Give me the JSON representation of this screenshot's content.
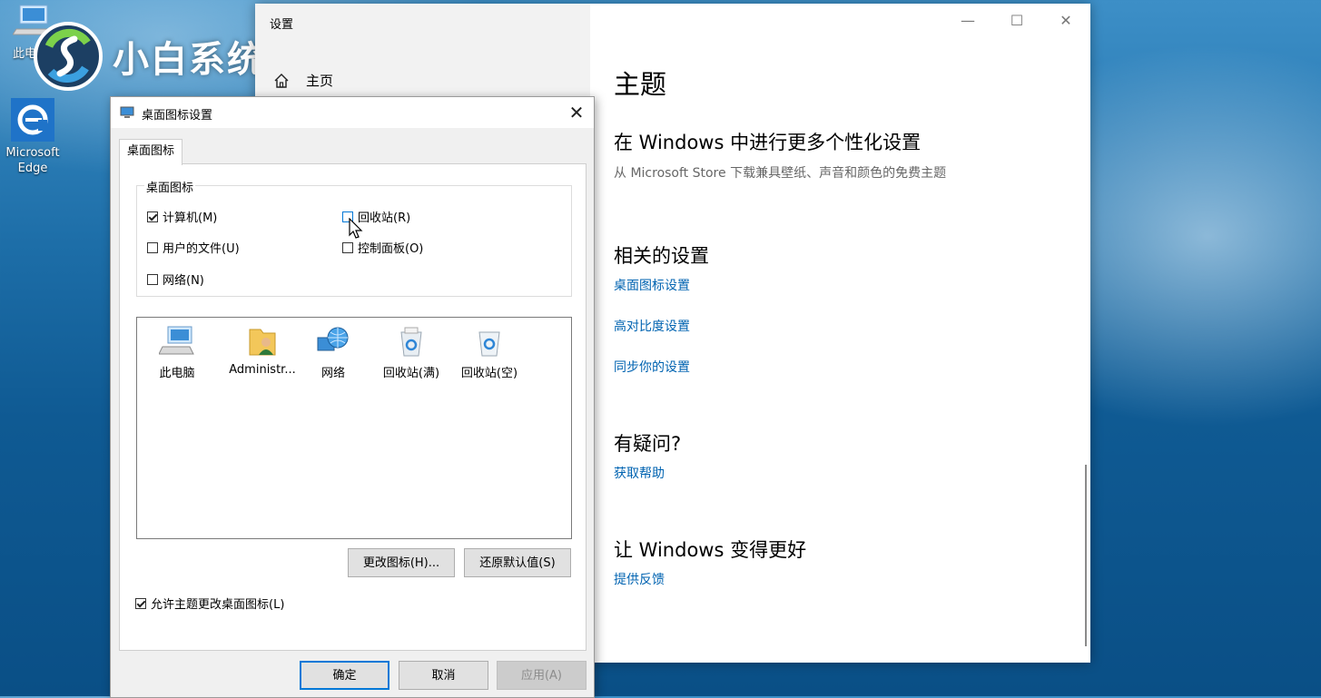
{
  "desktop": {
    "icon_this_pc_label_partial": "此电",
    "icon_edge_label": "Microsoft Edge",
    "watermark_text": "小白系统"
  },
  "settings": {
    "window_title": "设置",
    "home_label": "主页",
    "page_title": "主题",
    "section1": {
      "heading": "在 Windows 中进行更多个性化设置",
      "description": "从 Microsoft Store 下载兼具壁纸、声音和颜色的免费主题"
    },
    "related": {
      "heading": "相关的设置",
      "links": [
        "桌面图标设置",
        "高对比度设置",
        "同步你的设置"
      ]
    },
    "question": {
      "heading": "有疑问?",
      "link": "获取帮助"
    },
    "improve": {
      "heading": "让 Windows 变得更好",
      "link": "提供反馈"
    },
    "controls": {
      "minimize": "—",
      "maximize": "☐",
      "close": "✕"
    }
  },
  "dialog": {
    "title": "桌面图标设置",
    "close_glyph": "✕",
    "tab": "桌面图标",
    "group_label": "桌面图标",
    "checkboxes": [
      {
        "label": "计算机(M)",
        "checked": true
      },
      {
        "label": "回收站(R)",
        "checked": false
      },
      {
        "label": "用户的文件(U)",
        "checked": false
      },
      {
        "label": "控制面板(O)",
        "checked": false
      },
      {
        "label": "网络(N)",
        "checked": false
      }
    ],
    "icons": [
      {
        "label": "此电脑",
        "icon": "computer-icon"
      },
      {
        "label": "Administr...",
        "icon": "user-folder-icon"
      },
      {
        "label": "网络",
        "icon": "network-globe-icon"
      },
      {
        "label": "回收站(满)",
        "icon": "recycle-bin-full-icon"
      },
      {
        "label": "回收站(空)",
        "icon": "recycle-bin-empty-icon"
      }
    ],
    "change_icon_button": "更改图标(H)...",
    "restore_default_button": "还原默认值(S)",
    "allow_theme_checkbox": {
      "label": "允许主题更改桌面图标(L)",
      "checked": true
    },
    "ok_button": "确定",
    "cancel_button": "取消",
    "apply_button": "应用(A)"
  },
  "colors": {
    "link": "#0063b1",
    "accent": "#0078d7"
  }
}
